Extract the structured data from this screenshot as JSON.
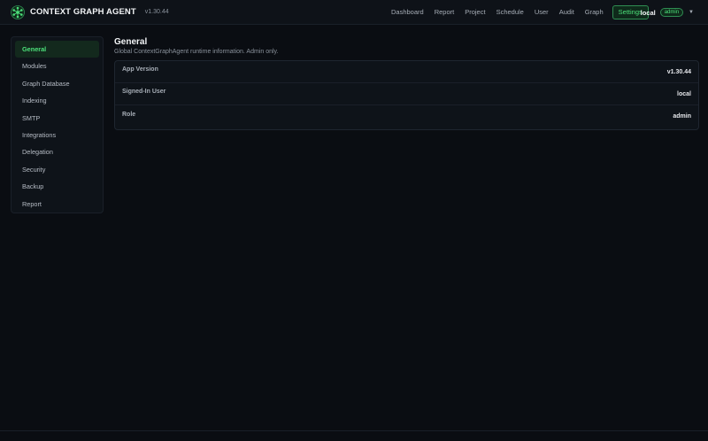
{
  "app": {
    "brand_name": "CONTEXT GRAPH AGENT",
    "version": "v1.30.44",
    "logo_icon": "graph-network-icon",
    "accent_color": "#4ce07a"
  },
  "nav": {
    "items": [
      {
        "label": "Dashboard"
      },
      {
        "label": "Report"
      },
      {
        "label": "Project"
      },
      {
        "label": "Schedule"
      },
      {
        "label": "User"
      },
      {
        "label": "Audit"
      },
      {
        "label": "Graph"
      },
      {
        "label": "Settings",
        "active": true
      }
    ]
  },
  "user": {
    "name": "local",
    "role": "admin",
    "menu_icon": "caret-down-icon"
  },
  "sidebar": {
    "items": [
      {
        "label": "General",
        "active": true
      },
      {
        "label": "Modules"
      },
      {
        "label": "Graph Database"
      },
      {
        "label": "Indexing"
      },
      {
        "label": "SMTP"
      },
      {
        "label": "Integrations"
      },
      {
        "label": "Delegation"
      },
      {
        "label": "Security"
      },
      {
        "label": "Backup"
      },
      {
        "label": "Report"
      }
    ]
  },
  "main": {
    "title": "General",
    "description": "Global ContextGraphAgent runtime information. Admin only.",
    "rows": [
      {
        "label": "App Version",
        "value": "v1.30.44"
      },
      {
        "label": "Signed-In User",
        "value": "local"
      },
      {
        "label": "Role",
        "value": "admin"
      }
    ]
  }
}
